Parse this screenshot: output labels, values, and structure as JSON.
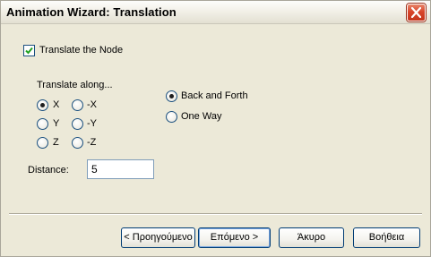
{
  "window": {
    "title": "Animation Wizard: Translation"
  },
  "translate_node": {
    "label": "Translate the Node",
    "checked": true
  },
  "translate_along": {
    "label": "Translate along...",
    "options": [
      "X",
      "-X",
      "Y",
      "-Y",
      "Z",
      "-Z"
    ],
    "selected": "X"
  },
  "motion": {
    "options": [
      "Back and Forth",
      "One Way"
    ],
    "selected": "Back and Forth"
  },
  "distance": {
    "label": "Distance:",
    "value": "5"
  },
  "buttons": {
    "back": "< Προηγούμενο",
    "next": "Επόμενο >",
    "cancel": "Άκυρο",
    "help": "Βοήθεια"
  }
}
